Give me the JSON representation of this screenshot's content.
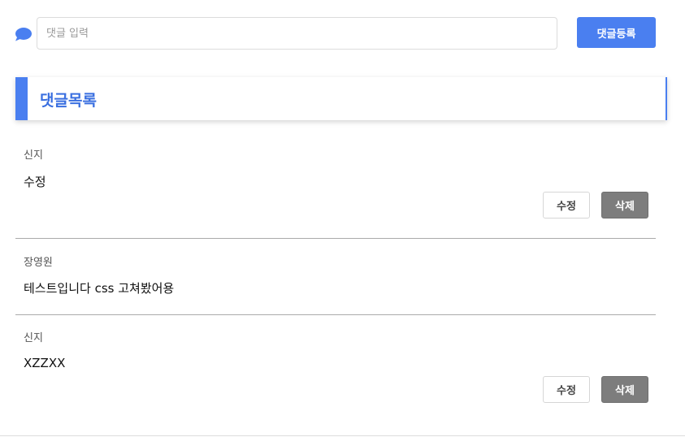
{
  "comment_form": {
    "placeholder": "댓글 입력",
    "value": "",
    "submit_label": "댓글등록",
    "icon": "speech-bubble-icon"
  },
  "comment_list": {
    "title": "댓글목록",
    "accent_color": "#4a7ff0",
    "items": [
      {
        "author": "신지",
        "content": "수정",
        "edit_label": "수정",
        "delete_label": "삭제"
      },
      {
        "author": "장영원",
        "content": "테스트입니다 css 고쳐봤어용"
      },
      {
        "author": "신지",
        "content": "XZZXX",
        "edit_label": "수정",
        "delete_label": "삭제"
      }
    ]
  }
}
